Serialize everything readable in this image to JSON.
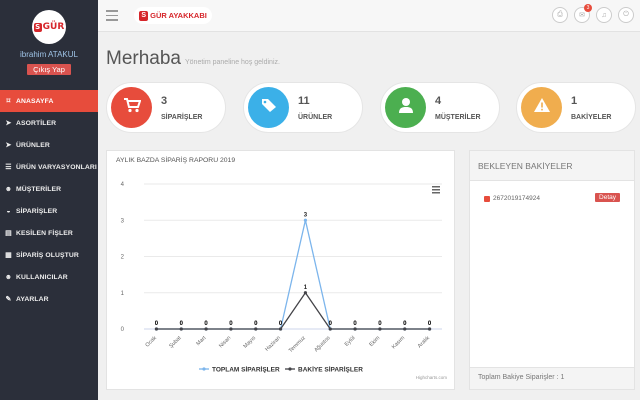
{
  "sidebar": {
    "logo_text": "GÜR",
    "logo_letter": "S",
    "user_name": "ibrahim ATAKUL",
    "logout_label": "Çıkış Yap",
    "items": [
      {
        "label": "ANASAYFA",
        "icon": "bookmark-icon",
        "glyph": "⌑",
        "active": true
      },
      {
        "label": "ASORTİLER",
        "icon": "tag-icon",
        "glyph": "➤"
      },
      {
        "label": "ÜRÜNLER",
        "icon": "tags-icon",
        "glyph": "➤"
      },
      {
        "label": "ÜRÜN VARYASYONLARI",
        "icon": "list-icon",
        "glyph": "☰"
      },
      {
        "label": "MÜŞTERİLER",
        "icon": "users-icon",
        "glyph": "☻"
      },
      {
        "label": "SİPARİŞLER",
        "icon": "cart-icon",
        "glyph": "◒"
      },
      {
        "label": "KESİLEN FİŞLER",
        "icon": "file-icon",
        "glyph": "▤"
      },
      {
        "label": "SİPARİŞ OLUŞTUR",
        "icon": "plus-file-icon",
        "glyph": "▦"
      },
      {
        "label": "KULLANICILAR",
        "icon": "user-icon",
        "glyph": "☻"
      },
      {
        "label": "AYARLAR",
        "icon": "wrench-icon",
        "glyph": "✎"
      }
    ]
  },
  "topbar": {
    "brand_letter": "S",
    "brand_text": "GÜR AYAKKABI",
    "notification_count": "3"
  },
  "header": {
    "title": "Merhaba",
    "subtitle": "Yönetim paneline hoş geldiniz."
  },
  "stats": [
    {
      "value": "3",
      "label": "SİPARİŞLER",
      "color": "#e74c3c",
      "icon": "cart-icon"
    },
    {
      "value": "11",
      "label": "ÜRÜNLER",
      "color": "#3bb0e8",
      "icon": "tags-icon"
    },
    {
      "value": "4",
      "label": "MÜŞTERİLER",
      "color": "#4caf50",
      "icon": "user-icon"
    },
    {
      "value": "1",
      "label": "BAKİYELER",
      "color": "#f0ad4e",
      "icon": "warning-icon"
    }
  ],
  "chart_data": {
    "type": "line",
    "title": "AYLIK BAZDA SİPARİŞ RAPORU 2019",
    "categories": [
      "Ocak",
      "Şubat",
      "Mart",
      "Nisan",
      "Mayıs",
      "Haziran",
      "Temmuz",
      "Ağustos",
      "Eylül",
      "Ekim",
      "Kasım",
      "Aralık"
    ],
    "series": [
      {
        "name": "TOPLAM SİPARİŞLER",
        "color": "#7cb5ec",
        "values": [
          0,
          0,
          0,
          0,
          0,
          0,
          3,
          0,
          0,
          0,
          0,
          0
        ]
      },
      {
        "name": "BAKİYE SİPARİŞLER",
        "color": "#434348",
        "values": [
          0,
          0,
          0,
          0,
          0,
          0,
          1,
          0,
          0,
          0,
          0,
          0
        ]
      }
    ],
    "ylim": [
      0,
      4
    ],
    "yticks": [
      0,
      1,
      2,
      3,
      4
    ],
    "grid": true,
    "legend": "bottom",
    "credits": "Highcharts.com"
  },
  "pending": {
    "title": "BEKLEYEN BAKİYELER",
    "items": [
      {
        "code": "2672019174924",
        "button": "Detay"
      }
    ],
    "footer": "Toplam Bakiye Siparişler : 1"
  }
}
